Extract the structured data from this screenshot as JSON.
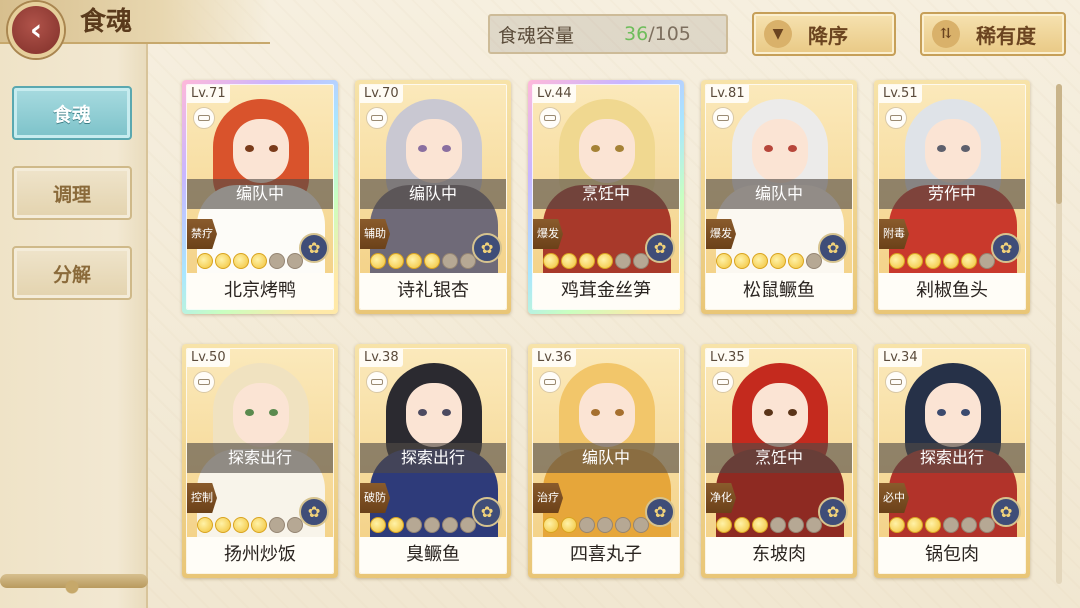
{
  "header": {
    "title": "食魂",
    "back_label": "‹"
  },
  "side_nav": [
    {
      "label": "食魂",
      "active": true
    },
    {
      "label": "调理",
      "active": false
    },
    {
      "label": "分解",
      "active": false
    }
  ],
  "capacity": {
    "label": "食魂容量",
    "current": "36",
    "separator": "/",
    "max": "105"
  },
  "sort": {
    "order_label": "降序",
    "order_icon": "▼",
    "rarity_label": "稀有度",
    "rarity_icon": "⇅"
  },
  "cards": [
    {
      "level": "Lv.71",
      "status": "编队中",
      "role": "禁疗",
      "name": "北京烤鸭",
      "stars": 4,
      "frame": "rainbow",
      "hair": "#d9532c",
      "robe": "#fdfcf8",
      "eye": "#7a3b1a"
    },
    {
      "level": "Lv.70",
      "status": "编队中",
      "role": "辅助",
      "name": "诗礼银杏",
      "stars": 4,
      "frame": "gold",
      "hair": "#c9c8d2",
      "robe": "#6f6a78",
      "eye": "#8a6fa0"
    },
    {
      "level": "Lv.44",
      "status": "烹饪中",
      "role": "爆发",
      "name": "鸡茸金丝笋",
      "stars": 4,
      "frame": "rainbow",
      "hair": "#f0d890",
      "robe": "#a8392a",
      "eye": "#a58236"
    },
    {
      "level": "Lv.81",
      "status": "编队中",
      "role": "爆发",
      "name": "松鼠鳜鱼",
      "stars": 5,
      "frame": "gold",
      "hair": "#ecebea",
      "robe": "#fbf8f1",
      "eye": "#b7463a"
    },
    {
      "level": "Lv.51",
      "status": "劳作中",
      "role": "附毒",
      "name": "剁椒鱼头",
      "stars": 5,
      "frame": "gold",
      "hair": "#dfe3e8",
      "robe": "#c9392c",
      "eye": "#5d5f6c"
    },
    {
      "level": "Lv.50",
      "status": "探索出行",
      "role": "控制",
      "name": "扬州炒饭",
      "stars": 4,
      "frame": "gold",
      "hair": "#f0e2c0",
      "robe": "#f8f4ea",
      "eye": "#5a8a4e"
    },
    {
      "level": "Lv.38",
      "status": "探索出行",
      "role": "破防",
      "name": "臭鳜鱼",
      "stars": 2,
      "frame": "gold",
      "hair": "#2b2a30",
      "robe": "#2e3b7a",
      "eye": "#4c4a60"
    },
    {
      "level": "Lv.36",
      "status": "编队中",
      "role": "治疗",
      "name": "四喜丸子",
      "stars": 2,
      "frame": "gold",
      "hair": "#f2c66a",
      "robe": "#e6a63a",
      "eye": "#a6702e"
    },
    {
      "level": "Lv.35",
      "status": "烹饪中",
      "role": "净化",
      "name": "东坡肉",
      "stars": 3,
      "frame": "gold",
      "hair": "#c42a1e",
      "robe": "#8e2a22",
      "eye": "#5a3418"
    },
    {
      "level": "Lv.34",
      "status": "探索出行",
      "role": "必中",
      "name": "锅包肉",
      "stars": 3,
      "frame": "gold",
      "hair": "#263148",
      "robe": "#b2332a",
      "eye": "#3b4a6e"
    }
  ]
}
